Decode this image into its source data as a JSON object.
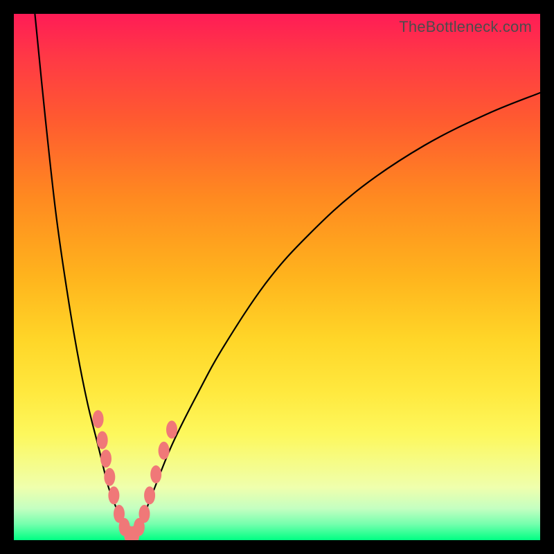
{
  "watermark": "TheBottleneck.com",
  "chart_data": {
    "type": "line",
    "title": "",
    "xlabel": "",
    "ylabel": "",
    "xlim": [
      0,
      100
    ],
    "ylim": [
      0,
      100
    ],
    "series": [
      {
        "name": "left-branch",
        "x": [
          4,
          6,
          8,
          10,
          12,
          14,
          16,
          18,
          19.5,
          21,
          22
        ],
        "y": [
          100,
          80,
          62,
          48,
          36,
          26,
          18,
          10,
          6,
          2,
          0
        ]
      },
      {
        "name": "right-branch",
        "x": [
          22,
          24,
          26,
          30,
          35,
          40,
          48,
          56,
          66,
          78,
          90,
          100
        ],
        "y": [
          0,
          3,
          8,
          18,
          28,
          37,
          49,
          58,
          67,
          75,
          81,
          85
        ]
      }
    ],
    "markers": {
      "name": "near-bottom-markers",
      "fill": "#f07878",
      "points": [
        {
          "x": 16.0,
          "y": 23.0
        },
        {
          "x": 16.8,
          "y": 19.0
        },
        {
          "x": 17.5,
          "y": 15.5
        },
        {
          "x": 18.2,
          "y": 12.0
        },
        {
          "x": 19.0,
          "y": 8.5
        },
        {
          "x": 20.0,
          "y": 5.0
        },
        {
          "x": 21.0,
          "y": 2.5
        },
        {
          "x": 22.0,
          "y": 1.0
        },
        {
          "x": 22.8,
          "y": 1.0
        },
        {
          "x": 23.8,
          "y": 2.5
        },
        {
          "x": 24.8,
          "y": 5.0
        },
        {
          "x": 25.8,
          "y": 8.5
        },
        {
          "x": 27.0,
          "y": 12.5
        },
        {
          "x": 28.5,
          "y": 17.0
        },
        {
          "x": 30.0,
          "y": 21.0
        }
      ]
    },
    "gradient_stops": [
      {
        "pos": 0,
        "color": "#ff1c56"
      },
      {
        "pos": 8,
        "color": "#ff3846"
      },
      {
        "pos": 20,
        "color": "#ff5a30"
      },
      {
        "pos": 35,
        "color": "#ff8a20"
      },
      {
        "pos": 50,
        "color": "#ffb41d"
      },
      {
        "pos": 62,
        "color": "#ffd628"
      },
      {
        "pos": 72,
        "color": "#ffe93f"
      },
      {
        "pos": 80,
        "color": "#fdf85d"
      },
      {
        "pos": 90,
        "color": "#efffad"
      },
      {
        "pos": 94,
        "color": "#c4ffc1"
      },
      {
        "pos": 97,
        "color": "#73ffad"
      },
      {
        "pos": 100,
        "color": "#00ff83"
      }
    ]
  }
}
